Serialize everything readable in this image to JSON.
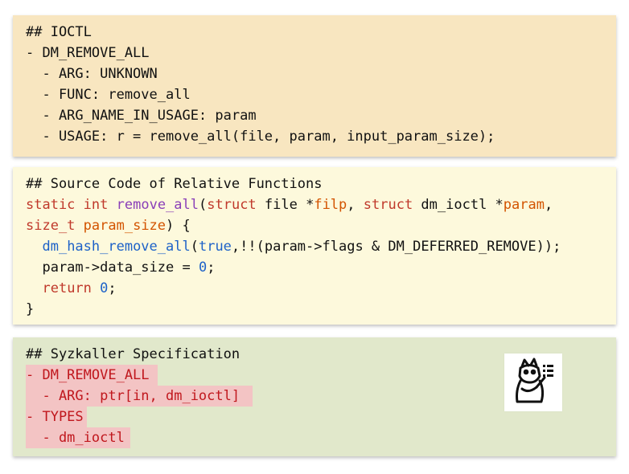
{
  "ioctl": {
    "heading": "## IOCTL",
    "name_line": "- DM_REMOVE_ALL",
    "arg_line": "  - ARG: UNKNOWN",
    "func_line": "  - FUNC: remove_all",
    "argname_line": "  - ARG_NAME_IN_USAGE: param",
    "usage_line": "  - USAGE: r = remove_all(file, param, input_param_size);"
  },
  "source": {
    "heading": "## Source Code of Relative Functions",
    "line1": {
      "kw_static": "static",
      "sp1": " ",
      "kw_int": "int",
      "sp2": " ",
      "fn": "remove_all",
      "open": "(",
      "kw_struct1": "struct",
      "file_ptr": " file *",
      "filp": "filp",
      "comma": ", ",
      "kw_struct2": "struct",
      "dm_ptr": " dm_ioctl *",
      "param": "param",
      "tail": ","
    },
    "line2": {
      "size_t": "size_t",
      "sp": " ",
      "param_size": "param_size",
      "tail": ") {"
    },
    "line3": {
      "indent": "  ",
      "call": "dm_hash_remove_all",
      "open": "(",
      "true": "true",
      "rest": ",!!(param->flags & DM_DEFERRED_REMOVE));"
    },
    "line4": {
      "pre": "  param->data_size = ",
      "num": "0",
      "tail": ";"
    },
    "line5": {
      "indent": "  ",
      "kw_return": "return",
      "sp": " ",
      "num": "0",
      "tail": ";"
    },
    "line6": "}"
  },
  "syzkaller": {
    "heading": "## Syzkaller Specification",
    "lines": [
      "- DM_REMOVE_ALL",
      "  - ARG: ptr[in, dm_ioctl]",
      "- TYPES",
      "  - dm_ioctl"
    ],
    "mascot_icon": "syzkaller-gopher-icon"
  },
  "colors": {
    "ioctl_bg": "#f8e6c0",
    "source_bg": "#fdf9dc",
    "syzkaller_bg": "#e1e8cb",
    "keyword": "#c0392b",
    "function_name": "#8a3fb8",
    "call": "#1e62c8",
    "parameter": "#d35400",
    "added_highlight_bg": "#f3c4c4",
    "added_highlight_text": "#c0171d"
  }
}
